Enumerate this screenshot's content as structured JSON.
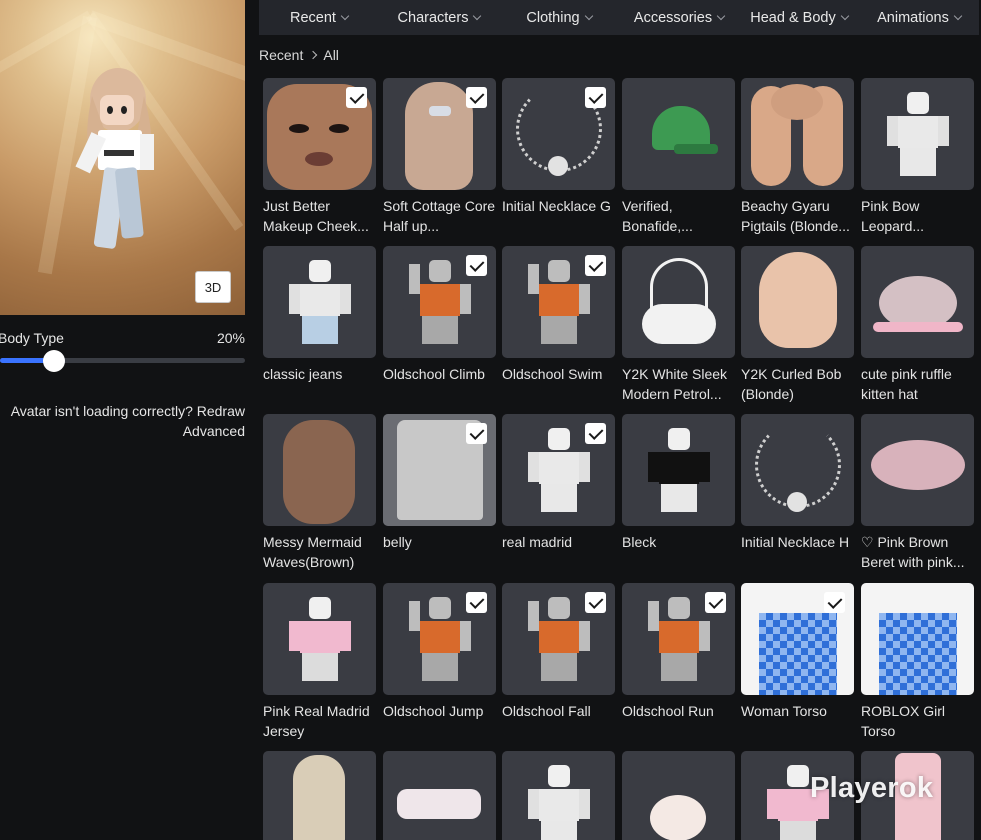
{
  "nav": {
    "tabs": [
      {
        "label": "Recent"
      },
      {
        "label": "Characters"
      },
      {
        "label": "Clothing"
      },
      {
        "label": "Accessories"
      },
      {
        "label": "Head & Body"
      },
      {
        "label": "Animations"
      }
    ]
  },
  "breadcrumb": {
    "root": "Recent",
    "current": "All"
  },
  "avatar": {
    "view_mode_button": "3D",
    "body_type_label": "Body Type",
    "body_type_value": "20%",
    "body_type_fraction": 0.22,
    "redraw_prompt": "Avatar isn't loading correctly? Redraw",
    "advanced_link": "Advanced"
  },
  "items": [
    {
      "name": "Just Better Makeup Cheek...",
      "checked": true,
      "thumb": "face"
    },
    {
      "name": "Soft Cottage Core Half up...",
      "checked": true,
      "thumb": "hair-back"
    },
    {
      "name": "Initial Necklace G",
      "checked": true,
      "thumb": "necklace"
    },
    {
      "name": "Verified, Bonafide,...",
      "checked": false,
      "thumb": "green-cap"
    },
    {
      "name": "Beachy Gyaru Pigtails (Blonde...",
      "checked": false,
      "thumb": "pigtails"
    },
    {
      "name": "Pink Bow Leopard...",
      "checked": false,
      "thumb": "avatar-white"
    },
    {
      "name": "classic jeans",
      "checked": false,
      "thumb": "avatar-jeans"
    },
    {
      "name": "Oldschool Climb",
      "checked": true,
      "thumb": "avatar-orange"
    },
    {
      "name": "Oldschool Swim",
      "checked": true,
      "thumb": "avatar-swim"
    },
    {
      "name": "Y2K White Sleek Modern Petrol...",
      "checked": false,
      "thumb": "bag"
    },
    {
      "name": "Y2K Curled Bob (Blonde)",
      "checked": false,
      "thumb": "bob"
    },
    {
      "name": "cute pink ruffle kitten hat",
      "checked": false,
      "thumb": "kitten-hat"
    },
    {
      "name": "Messy Mermaid Waves(Brown)",
      "checked": false,
      "thumb": "brown-hair"
    },
    {
      "name": "belly",
      "checked": true,
      "thumb": "shirt"
    },
    {
      "name": "real madrid",
      "checked": true,
      "thumb": "avatar-white"
    },
    {
      "name": "Bleck",
      "checked": false,
      "thumb": "avatar-black"
    },
    {
      "name": "Initial Necklace H",
      "checked": false,
      "thumb": "necklace-h"
    },
    {
      "name": "♡ Pink Brown Beret with pink...",
      "checked": false,
      "thumb": "beret"
    },
    {
      "name": "Pink Real Madrid Jersey",
      "checked": false,
      "thumb": "avatar-pink"
    },
    {
      "name": "Oldschool Jump",
      "checked": true,
      "thumb": "avatar-orange"
    },
    {
      "name": "Oldschool Fall",
      "checked": true,
      "thumb": "avatar-orange"
    },
    {
      "name": "Oldschool Run",
      "checked": true,
      "thumb": "avatar-run"
    },
    {
      "name": "Woman Torso",
      "checked": true,
      "thumb": "torso-blue"
    },
    {
      "name": "ROBLOX Girl Torso",
      "checked": false,
      "thumb": "torso-blue"
    },
    {
      "name": "",
      "checked": false,
      "thumb": "long-hair"
    },
    {
      "name": "",
      "checked": false,
      "thumb": "ruffle"
    },
    {
      "name": "",
      "checked": false,
      "thumb": "avatar-white"
    },
    {
      "name": "",
      "checked": false,
      "thumb": "cat-bun"
    },
    {
      "name": "",
      "checked": false,
      "thumb": "avatar-pink"
    },
    {
      "name": "",
      "checked": false,
      "thumb": "phone-case"
    }
  ],
  "watermark": "Playerok"
}
